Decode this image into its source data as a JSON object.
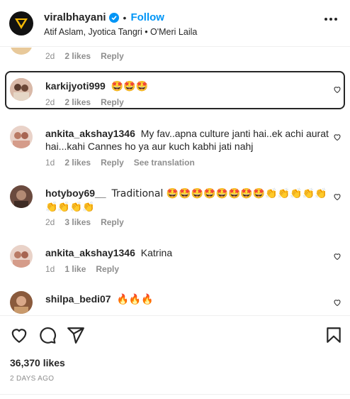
{
  "header": {
    "username": "viralbhayani",
    "follow_label": "Follow",
    "separator": "•",
    "subtitle": "Atif Aslam, Jyotica Tangri • O'Meri Laila"
  },
  "comments": [
    {
      "username": "",
      "text": "",
      "time": "2d",
      "likes": "2 likes",
      "reply": "Reply"
    },
    {
      "username": "karkijyoti999",
      "text": "🤩🤩🤩",
      "time": "2d",
      "likes": "2 likes",
      "reply": "Reply"
    },
    {
      "username": "ankita_akshay1346",
      "text": "My fav..apna culture janti hai..ek achi aurat hai...kahi Cannes ho ya aur kuch kabhi jati nahj",
      "time": "1d",
      "likes": "2 likes",
      "reply": "Reply",
      "translation": "See translation"
    },
    {
      "username": "hotyboy69__",
      "text": "Traditional 🤩🤩🤩🤩🤩🤩🤩🤩👏👏👏👏👏👏👏👏👏",
      "time": "2d",
      "likes": "3 likes",
      "reply": "Reply"
    },
    {
      "username": "ankita_akshay1346",
      "text": "Katrina",
      "time": "1d",
      "likes": "1 like",
      "reply": "Reply"
    },
    {
      "username": "shilpa_bedi07",
      "text": "🔥🔥🔥",
      "time": "",
      "likes": "",
      "reply": ""
    }
  ],
  "footer": {
    "likes": "36,370 likes",
    "date": "2 DAYS AGO"
  },
  "colors": {
    "accent": "#0095f6",
    "text": "#262626",
    "muted": "#8e8e8e"
  },
  "icons": [
    "verified-badge-icon",
    "more-options-icon",
    "heart-icon",
    "comment-icon",
    "share-icon",
    "save-icon"
  ]
}
